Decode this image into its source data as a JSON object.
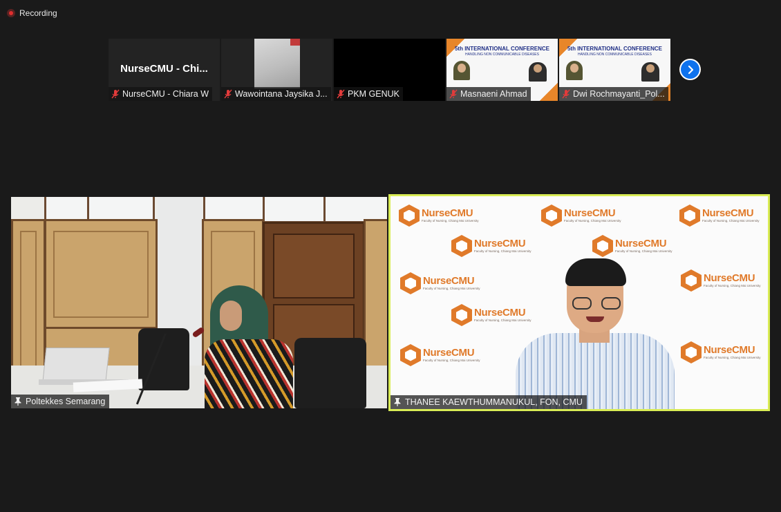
{
  "recording": {
    "label": "Recording"
  },
  "gallery_strip": {
    "participants": [
      {
        "name": "NurseCMU - Chiara W",
        "display_name": "NurseCMU  -  Chi...",
        "muted": true,
        "video": "off"
      },
      {
        "name": "Wawointana Jaysika J...",
        "muted": true,
        "video": "camera"
      },
      {
        "name": "PKM GENUK",
        "muted": true,
        "video": "black"
      },
      {
        "name": "Masnaeni Ahmad",
        "muted": true,
        "video": "slide",
        "slide_title": "5th INTERNATIONAL CONFERENCE",
        "slide_subtitle": "HANDLING NON COMMUNICABLE DISEASES"
      },
      {
        "name": "Dwi Rochmayanti_Pol...",
        "muted": true,
        "video": "slide",
        "slide_title": "5th INTERNATIONAL CONFERENCE",
        "slide_subtitle": "HANDLING NON COMMUNICABLE DISEASES"
      }
    ],
    "next_page_icon": "chevron-right-icon"
  },
  "main_tiles": [
    {
      "name": "Poltekkes Semarang",
      "pinned": true,
      "active_speaker": false
    },
    {
      "name": "THANEE KAEWTHUMMANUKUL, FON, CMU",
      "pinned": true,
      "active_speaker": true,
      "backdrop_logo": {
        "text": "NurseCMU",
        "tagline": "Faculty of Nursing, Chiang Mai University"
      }
    }
  ],
  "colors": {
    "background": "#1a1a1a",
    "active_speaker_border": "#d9ec55",
    "accent": "#0e72ed",
    "brand_orange": "#e07a2a"
  }
}
